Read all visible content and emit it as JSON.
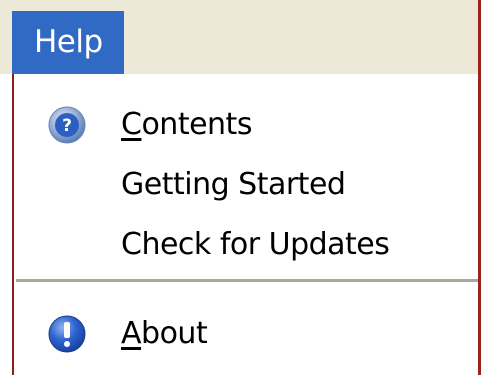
{
  "menubar": {
    "title": "Help"
  },
  "menu": {
    "items": [
      {
        "label_mnemonic": "C",
        "label_rest": "ontents",
        "icon": "help-question-icon"
      },
      {
        "label": "Getting Started"
      },
      {
        "label": "Check for Updates"
      },
      {
        "label_mnemonic": "A",
        "label_rest": "bout",
        "icon": "info-exclamation-icon"
      }
    ]
  },
  "colors": {
    "menubar_bg": "#ece9d8",
    "highlight": "#316ac5",
    "border": "#8b1f1f"
  }
}
